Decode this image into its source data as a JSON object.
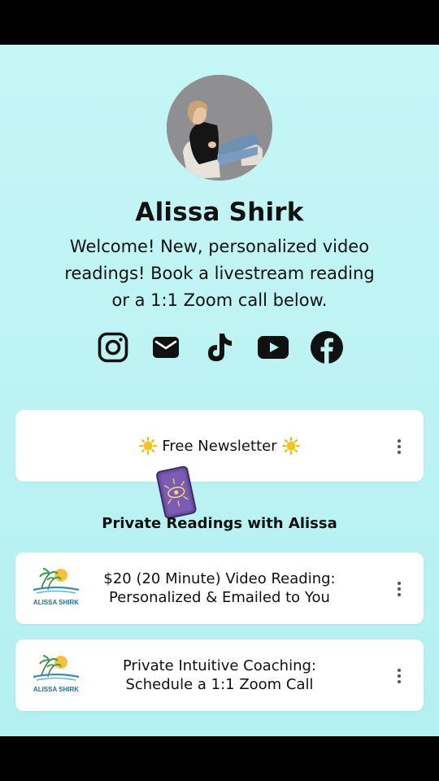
{
  "profile": {
    "name": "Alissa Shirk",
    "bio": "Welcome! New, personalized video readings! Book a livestream reading or a 1:1 Zoom call below."
  },
  "socials": [
    {
      "icon": "instagram-icon"
    },
    {
      "icon": "email-icon"
    },
    {
      "icon": "tiktok-icon"
    },
    {
      "icon": "youtube-icon"
    },
    {
      "icon": "facebook-icon"
    }
  ],
  "links": {
    "newsletter": {
      "label": "Free Newsletter",
      "icon": "sun-emoji"
    },
    "section_heading": "Private Readings with Alissa",
    "video_reading": {
      "line1": "$20 (20 Minute) Video Reading:",
      "line2": "Personalized & Emailed to You",
      "thumb_text": "ALISSA SHIRK"
    },
    "coaching": {
      "line1": "Private Intuitive Coaching:",
      "line2": "Schedule a 1:1 Zoom Call",
      "thumb_text": "ALISSA SHIRK"
    }
  },
  "colors": {
    "background": "#bff3f4",
    "card": "#ffffff",
    "text": "#111111",
    "sticker": "#6b4fa0"
  }
}
